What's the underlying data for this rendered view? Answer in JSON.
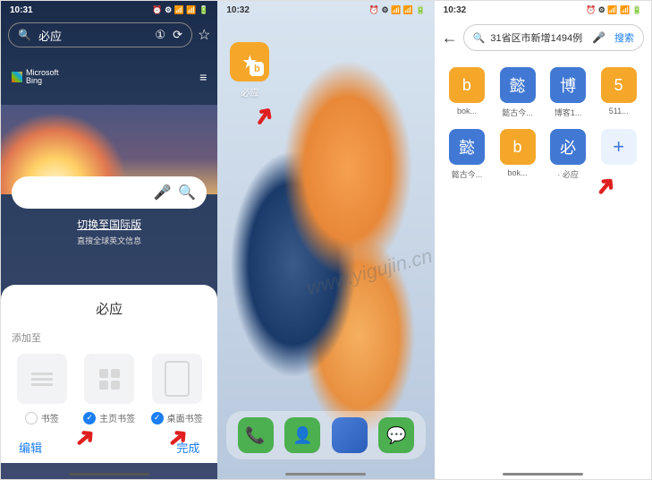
{
  "watermark": "www.yigujin.cn",
  "phone1": {
    "time": "10:31",
    "status_icons": "⏰ ⚙ 📶 📶 🔋",
    "search_text": "必应",
    "bing_brand": "Microsoft\nBing",
    "intl_link": "切换至国际版",
    "intl_sub": "直搜全球英文信息",
    "sheet_title": "必应",
    "add_to_label": "添加至",
    "options": [
      {
        "label": "书签",
        "checked": false
      },
      {
        "label": "主页书签",
        "checked": true
      },
      {
        "label": "桌面书签",
        "checked": true
      }
    ],
    "btn_edit": "编辑",
    "btn_done": "完成"
  },
  "phone2": {
    "time": "10:32",
    "status_icons": "⏰ ⚙ 📶 📶 🔋",
    "shortcut_label": "必应"
  },
  "phone3": {
    "time": "10:32",
    "status_icons": "⏰ ⚙ 📶 📶 🔋",
    "search_text": "31省区市新增1494例",
    "btn_search": "搜索",
    "favs": [
      {
        "icon": "b",
        "label": "bok...",
        "color": "o"
      },
      {
        "icon": "懿",
        "label": "懿古今...",
        "color": "b"
      },
      {
        "icon": "博",
        "label": "博客1...",
        "color": "b"
      },
      {
        "icon": "5",
        "label": "511...",
        "color": "o"
      },
      {
        "icon": "懿",
        "label": "懿古今...",
        "color": "b"
      },
      {
        "icon": "b",
        "label": "bok...",
        "color": "o"
      },
      {
        "icon": "必",
        "label": "· 必应",
        "color": "b"
      },
      {
        "icon": "+",
        "label": "",
        "color": "plus"
      }
    ]
  }
}
